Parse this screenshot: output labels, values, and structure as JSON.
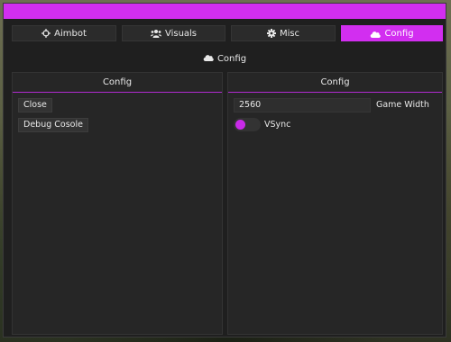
{
  "colors": {
    "accent": "#d22ef0",
    "window_bg": "#1f1f1f",
    "panel_bg": "#262626",
    "control_bg": "#333333",
    "text": "#e8e8e8"
  },
  "tabs": [
    {
      "label": "Aimbot",
      "icon": "crosshair-icon",
      "active": false
    },
    {
      "label": "Visuals",
      "icon": "users-icon",
      "active": false
    },
    {
      "label": "Misc",
      "icon": "gear-icon",
      "active": false
    },
    {
      "label": "Config",
      "icon": "cloud-icon",
      "active": true
    }
  ],
  "subheader": {
    "label": "Config",
    "icon": "cloud-icon"
  },
  "left_panel": {
    "title": "Config",
    "buttons": [
      {
        "label": "Close"
      },
      {
        "label": "Debug Cosole"
      }
    ]
  },
  "right_panel": {
    "title": "Config",
    "game_width": {
      "value": "2560",
      "label": "Game Width"
    },
    "vsync": {
      "label": "VSync",
      "enabled": false
    }
  }
}
